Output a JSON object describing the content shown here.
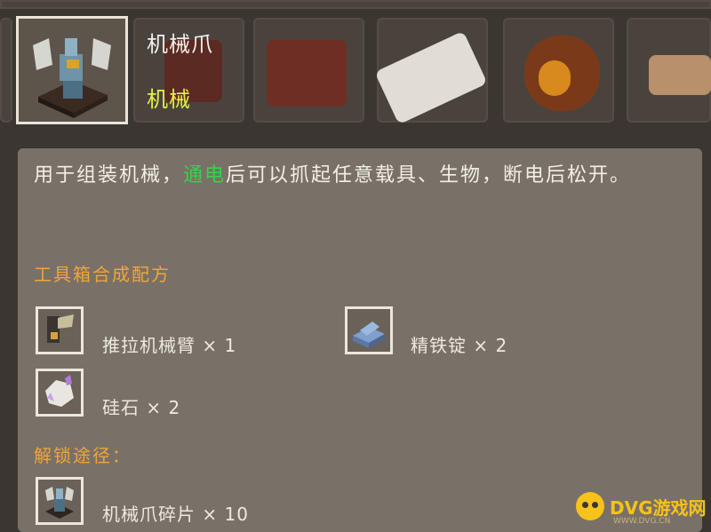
{
  "selected_item": {
    "name": "机械爪",
    "category": "机械",
    "icon": "mechanical-claw-icon"
  },
  "tooltip": {
    "description_before": "用于组装机械，",
    "description_highlight": "通电",
    "description_after": "后可以抓起任意载具、生物，断电后松开。",
    "highlight_color": "#37d24a",
    "recipe_heading": "工具箱合成配方",
    "recipe": [
      {
        "name": "推拉机械臂 × 1",
        "icon": "push-pull-arm-icon"
      },
      {
        "name": "精铁锭 × 2",
        "icon": "refined-iron-ingot-icon"
      },
      {
        "name": "硅石 × 2",
        "icon": "silica-stone-icon"
      }
    ],
    "unlock_heading": "解锁途径：",
    "unlock": [
      {
        "name": "机械爪碎片 × 10",
        "icon": "claw-fragment-icon"
      }
    ]
  },
  "watermark": {
    "text": "DVG游戏网",
    "subtext": "WWW.DVG.CN"
  },
  "colors": {
    "title": "#f2f0ea",
    "category": "#e6f04a",
    "section_heading": "#f2a43a"
  }
}
